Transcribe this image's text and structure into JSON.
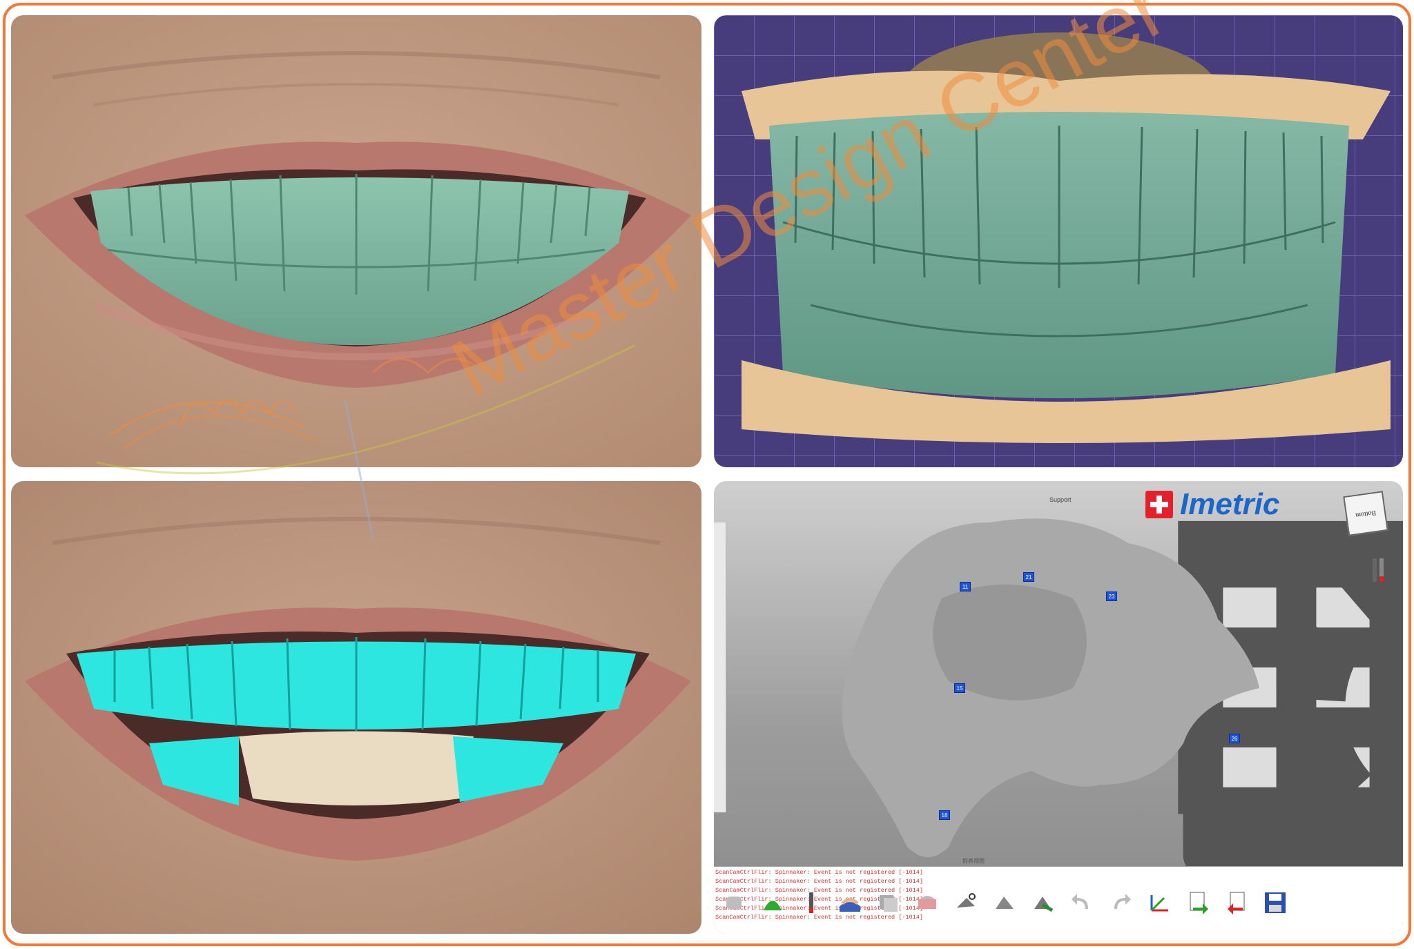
{
  "app": {
    "brand": "Imetric",
    "support_label": "Support",
    "viewcube_label": "Bottom"
  },
  "console": {
    "title": "报表视图",
    "lines": [
      "ScanCamCtrlFlir: Spinnaker: Event is not registered [-1014]",
      "ScanCamCtrlFlir: Spinnaker: Event is not registered [-1014]",
      "ScanCamCtrlFlir: Spinnaker: Event is not registered [-1014]",
      "ScanCamCtrlFlir: Spinnaker: Event is not registered [-1014]",
      "ScanCamCtrlFlir: Spinnaker: Event is not registered [-1014]",
      "ScanCamCtrlFlir: Spinnaker: Event is not registered [-1014]"
    ]
  },
  "scan_markers": [
    "11",
    "21",
    "23",
    "15",
    "26",
    "18"
  ],
  "toolbar": {
    "tools": [
      "scan-body-icon",
      "green-arch-icon",
      "implant-tool-icon",
      "model-base-icon",
      "stl-stack-icon",
      "articulator-icon",
      "cut-scissors-icon",
      "align-icon",
      "green-scan-icon",
      "undo-icon",
      "redo-icon",
      "axis-icon",
      "export-icon",
      "import-icon",
      "save-icon"
    ]
  },
  "watermark": {
    "text": "Master Design Center"
  },
  "colors": {
    "frame": "#ef7a3a",
    "tooth_green": "#7fb6a2",
    "tooth_cyan": "#2de6e0",
    "grid_purple": "#473c7c",
    "gingiva_tan": "#e8c597",
    "brand_blue": "#1b67c9",
    "log_red": "#d23030"
  }
}
